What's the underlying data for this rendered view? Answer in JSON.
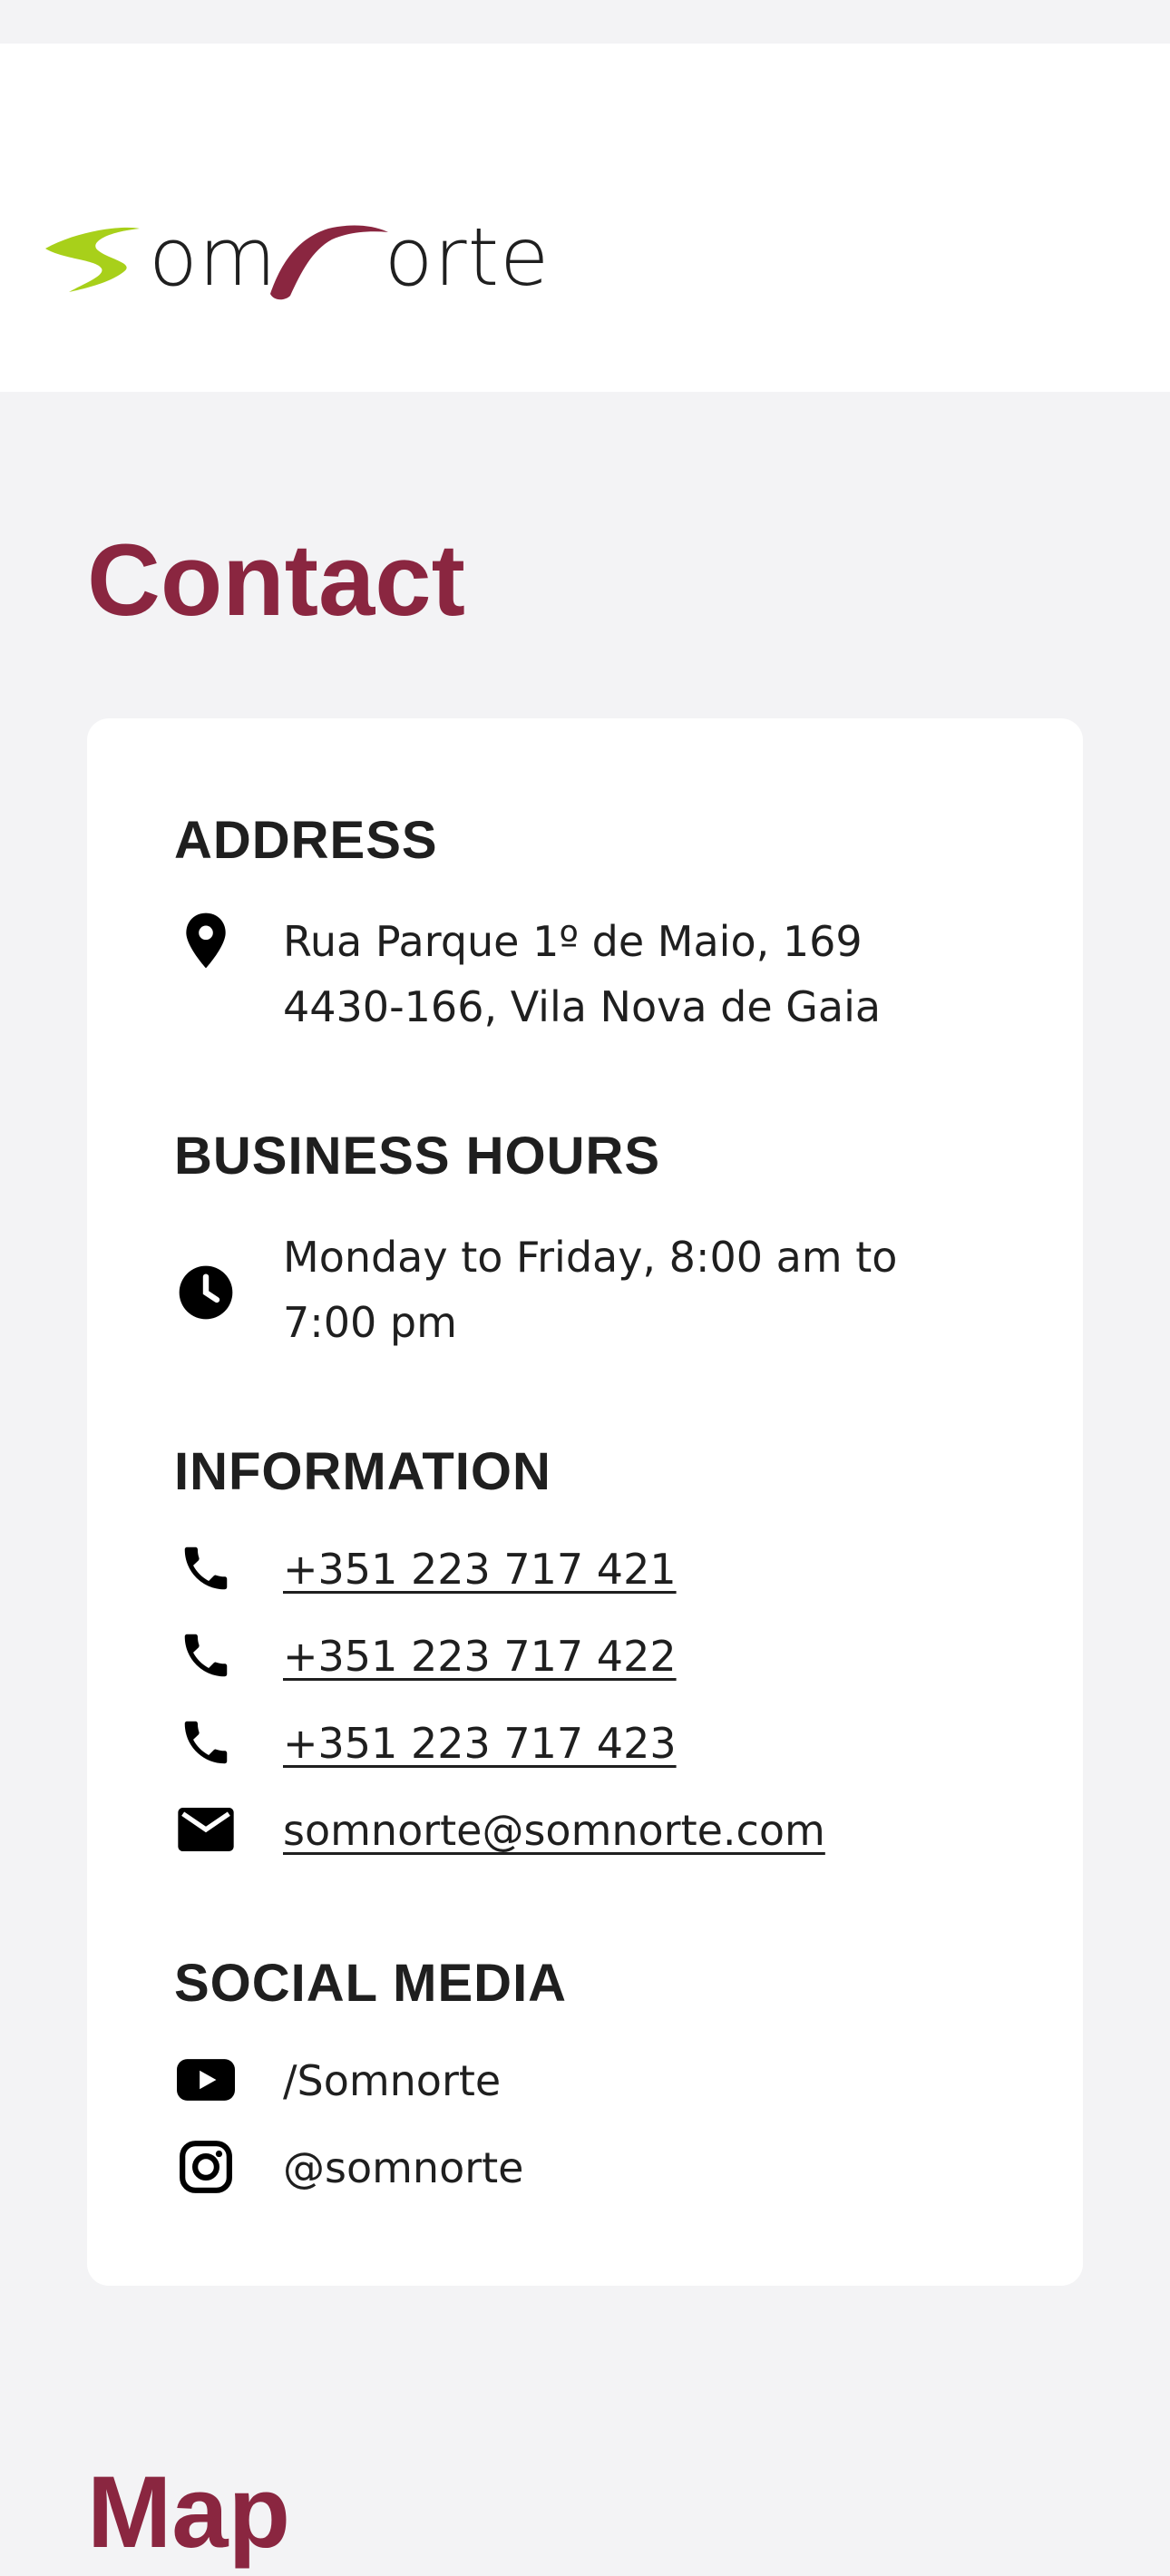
{
  "brand": {
    "logo_text": "Somnorte",
    "logo_visible_a": "om",
    "logo_visible_b": "orte",
    "colors": {
      "accent": "#8a2640",
      "logo_green": "#a8d01a",
      "logo_red": "#8a2640"
    }
  },
  "contact": {
    "title": "Contact",
    "address": {
      "title": "ADDRESS",
      "icon": "location-pin-icon",
      "text": "Rua Parque 1º de Maio, 169 4430-166, Vila Nova de Gaia"
    },
    "hours": {
      "title": "BUSINESS HOURS",
      "icon": "clock-icon",
      "text": "Monday to Friday, 8:00 am to 7:00 pm"
    },
    "information": {
      "title": "INFORMATION",
      "items": [
        {
          "icon": "phone-icon",
          "text": "+351 223 717 421"
        },
        {
          "icon": "phone-icon",
          "text": "+351 223 717 422"
        },
        {
          "icon": "phone-icon",
          "text": "+351 223 717 423"
        },
        {
          "icon": "mail-icon",
          "text": "somnorte@somnorte.com"
        }
      ]
    },
    "social": {
      "title": "SOCIAL MEDIA",
      "items": [
        {
          "icon": "youtube-icon",
          "text": "/Somnorte"
        },
        {
          "icon": "instagram-icon",
          "text": "@somnorte"
        }
      ]
    }
  },
  "map": {
    "title": "Map"
  }
}
